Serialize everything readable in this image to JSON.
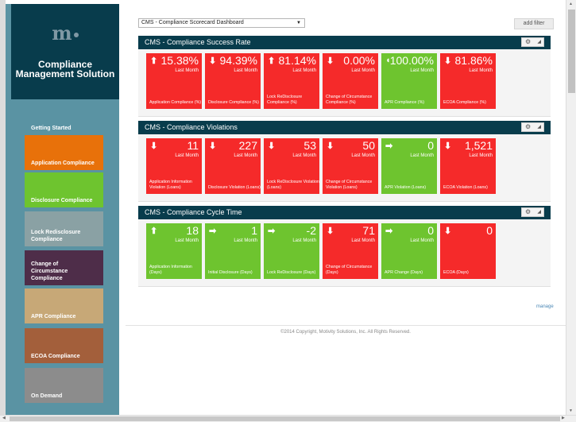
{
  "logo": "m",
  "app_title": "Compliance Management Solution",
  "nav": [
    {
      "label": "Getting Started",
      "color": "#5a93a3"
    },
    {
      "label": "Application Compliance",
      "color": "#e8710a"
    },
    {
      "label": "Disclosure Compliance",
      "color": "#6ec42f"
    },
    {
      "label": "Lock Redisclosure Compliance",
      "color": "#8aa1a4"
    },
    {
      "label": "Change of Circumstance Compliance",
      "color": "#4e2d49"
    },
    {
      "label": "APR Compliance",
      "color": "#c7a877"
    },
    {
      "label": "ECOA Compliance",
      "color": "#a35f3b"
    },
    {
      "label": "On Demand",
      "color": "#8c8c8c"
    }
  ],
  "dashboard_select": "CMS - Compliance Scorecard Dashboard",
  "add_filter": "add filter",
  "sections": [
    {
      "title": "CMS - Compliance Success Rate",
      "tiles": [
        {
          "arrow": "up",
          "value": "15.38%",
          "period": "Last Month",
          "label": "Application Compliance (%)",
          "status": "red"
        },
        {
          "arrow": "down",
          "value": "94.39%",
          "period": "Last Month",
          "label": "Disclosure Compliance (%)",
          "status": "red"
        },
        {
          "arrow": "up",
          "value": "81.14%",
          "period": "Last Month",
          "label": "Lock ReDisclosure Compliance (%)",
          "status": "red"
        },
        {
          "arrow": "down",
          "value": "0.00%",
          "period": "Last Month",
          "label": "Change of Circumstance Compliance (%)",
          "status": "red"
        },
        {
          "arrow": "neutral",
          "value": "100.00%",
          "period": "Last Month",
          "label": "APR Compliance (%)",
          "status": "green"
        },
        {
          "arrow": "down",
          "value": "81.86%",
          "period": "Last Month",
          "label": "ECOA Compliance (%)",
          "status": "red"
        }
      ]
    },
    {
      "title": "CMS - Compliance Violations",
      "tiles": [
        {
          "arrow": "down",
          "value": "11",
          "period": "Last Month",
          "label": "Application Information Violation (Loans)",
          "status": "red"
        },
        {
          "arrow": "down",
          "value": "227",
          "period": "Last Month",
          "label": "Disclosure Violation (Loans)",
          "status": "red"
        },
        {
          "arrow": "down",
          "value": "53",
          "period": "Last Month",
          "label": "Lock ReDisclosure Violation (Loans)",
          "status": "red"
        },
        {
          "arrow": "down",
          "value": "50",
          "period": "Last Month",
          "label": "Change of Circumstance Violation (Loans)",
          "status": "red"
        },
        {
          "arrow": "right",
          "value": "0",
          "period": "Last Month",
          "label": "APR Violation (Loans)",
          "status": "green"
        },
        {
          "arrow": "down",
          "value": "1,521",
          "period": "Last Month",
          "label": "ECOA Violation (Loans)",
          "status": "red"
        }
      ]
    },
    {
      "title": "CMS - Compliance Cycle Time",
      "tiles": [
        {
          "arrow": "up",
          "value": "18",
          "period": "Last Month",
          "label": "Application Information (Days)",
          "status": "green"
        },
        {
          "arrow": "right",
          "value": "1",
          "period": "Last Month",
          "label": "Initial Disclosure (Days)",
          "status": "green"
        },
        {
          "arrow": "right",
          "value": "-2",
          "period": "Last Month",
          "label": "Lock ReDisclosure (Days)",
          "status": "green"
        },
        {
          "arrow": "down",
          "value": "71",
          "period": "Last Month",
          "label": "Change of Circumstance (Days)",
          "status": "red"
        },
        {
          "arrow": "right",
          "value": "0",
          "period": "Last Month",
          "label": "APR Change (Days)",
          "status": "green"
        },
        {
          "arrow": "down",
          "value": "0",
          "period": "",
          "label": "ECOA (Days)",
          "status": "red"
        }
      ]
    }
  ],
  "manage": "manage",
  "copyright": "©2014 Copyright, Motivity Solutions, Inc. All Rights Reserved."
}
